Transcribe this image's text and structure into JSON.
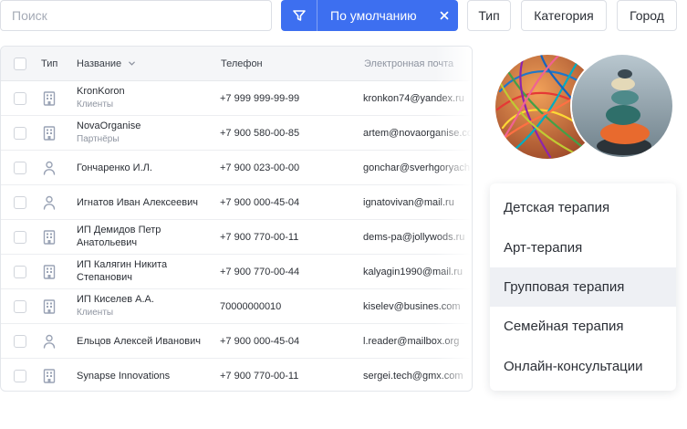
{
  "search": {
    "placeholder": "Поиск"
  },
  "sort": {
    "label": "По умолчанию"
  },
  "filters": [
    "Тип",
    "Категория",
    "Город"
  ],
  "table": {
    "columns": [
      "Тип",
      "Название",
      "Телефон",
      "Электронная почта"
    ],
    "rows": [
      {
        "type": "building",
        "name": "KronKoron",
        "sub": "Клиенты",
        "phone": "+7 999 999-99-99",
        "email": "kronkon74@yandex.ru"
      },
      {
        "type": "building",
        "name": "NovaOrganise",
        "sub": "Партнёры",
        "phone": "+7 900 580-00-85",
        "email": "artem@novaorganise.com"
      },
      {
        "type": "person",
        "name": "Гончаренко И.Л.",
        "sub": "",
        "phone": "+7 900 023-00-00",
        "email": "gonchar@sverhgoryachiy.ru"
      },
      {
        "type": "person",
        "name": "Игнатов Иван Алексеевич",
        "sub": "",
        "phone": "+7 900 000-45-04",
        "email": "ignatovivan@mail.ru"
      },
      {
        "type": "building",
        "name": "ИП Демидов Петр",
        "sub": "Анатольевич",
        "phone": "+7 900 770-00-11",
        "email": "dems-pa@jollywods.ru"
      },
      {
        "type": "building",
        "name": "ИП Калягин Никита",
        "sub": "Степанович",
        "phone": "+7 900 770-00-44",
        "email": "kalyagin1990@mail.ru"
      },
      {
        "type": "building",
        "name": "ИП Киселев А.А.",
        "sub": "Клиенты",
        "phone": "70000000010",
        "email": "kiselev@busines.com"
      },
      {
        "type": "person",
        "name": "Ельцов Алексей Иванович",
        "sub": "",
        "phone": "+7 900 000-45-04",
        "email": "l.reader@mailbox.org"
      },
      {
        "type": "building",
        "name": "Synapse Innovations",
        "sub": "",
        "phone": "+7 900 770-00-11",
        "email": "sergei.tech@gmx.com"
      }
    ]
  },
  "menu": {
    "items": [
      "Детская терапия",
      "Арт-терапия",
      "Групповая терапия",
      "Семейная терапия",
      "Онлайн-консультации"
    ],
    "highlighted_index": 2
  },
  "colors": {
    "accent": "#3d6ff0",
    "icon": "#9aa3b5",
    "highlight": "#eef0f4"
  },
  "icons": {
    "filter": "funnel-icon",
    "clear": "close-icon",
    "sort": "chevron-down-icon",
    "company": "building-icon",
    "person": "person-icon"
  }
}
